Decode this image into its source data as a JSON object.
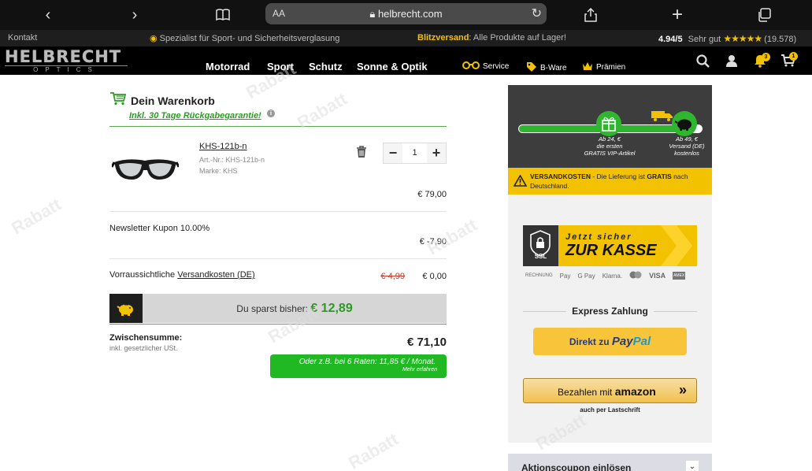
{
  "browser": {
    "aa_label": "AA",
    "url": "helbrecht.com"
  },
  "infobar": {
    "contact": "Kontakt",
    "tagline": "Spezialist für Sport- und Sicherheitsverglasung",
    "express_bold": "Blitzversand",
    "express_rest": ": Alle Produkte auf Lager!",
    "rating_value": "4.94/5",
    "rating_text": "Sehr gut",
    "rating_stars": "★★★★★",
    "rating_count": "(19.578)"
  },
  "header": {
    "logo_top": "HELBRECHT",
    "logo_bottom": "OPTICS",
    "nav": [
      "Motorrad",
      "Sport",
      "Schutz",
      "Sonne & Optik"
    ],
    "service": "Service",
    "bware": "B-Ware",
    "praemien": "Prämien",
    "notif_count": "3",
    "cart_count": "1"
  },
  "cart": {
    "title": "Dein Warenkorb",
    "guarantee_prefix": "Inkl.",
    "guarantee_text": "30 Tage Rückgabegarantie!",
    "info_glyph": "i",
    "item": {
      "name": "KHS-121b-n",
      "sku": "Art.-Nr.: KHS-121b-n",
      "brand": "Marke: KHS",
      "qty": "1",
      "minus": "−",
      "plus": "+",
      "price": "€ 79,00"
    },
    "coupon_label": "Newsletter Kupon 10.00%",
    "coupon_amount": "€ -7,90",
    "shipping_label_prefix": "Vorraussichtliche",
    "shipping_label_link": "Versandkosten (DE)",
    "shipping_old": "€ 4,99",
    "shipping_new": "€ 0,00",
    "savings_label": "Du sparst bisher:",
    "savings_amount": "€ 12,89",
    "subtotal_label": "Zwischensumme:",
    "subtotal_sub": "inkl. gesetzlicher USt.",
    "subtotal": "€ 71,10",
    "installment_text": "Oder z.B. bei 6 Raten: 11,85 € / Monat.",
    "installment_more": "Mehr erfahren"
  },
  "sidebar": {
    "progress": 0.93,
    "milestone1": "Ab 24,  €\ndie ersten\nGRATIS VIP-Artikel",
    "milestone2": "Ab 49,  €\nVersand (DE)\nkostenlos",
    "warn_bold": "VERSANDKOSTEN",
    "warn_text": " - Die Lieferung ist ",
    "warn_gratis": "GRATIS",
    "warn_end": " nach Deutschland.",
    "ssl_label": "SSL",
    "checkout_line1": "Jetzt sicher",
    "checkout_line2": "ZUR KASSE",
    "pay_icons": [
      "RECHNUNG",
      "Pay",
      "G Pay",
      "Klarna.",
      "VISA",
      "AMEX"
    ],
    "express_title": "Express Zahlung",
    "paypal_prefix": "Direkt zu",
    "paypal_p1": "Pay",
    "paypal_p2": "Pal",
    "amazon_prefix": "Bezahlen mit",
    "amazon_brand": "amazon",
    "amazon_sub": "auch per Lastschrift",
    "coupon_title": "Aktionscoupon einlösen"
  },
  "colors": {
    "accent_yellow": "#f2c200",
    "success_green": "#2c9b25",
    "dark": "#1e1e1e"
  }
}
